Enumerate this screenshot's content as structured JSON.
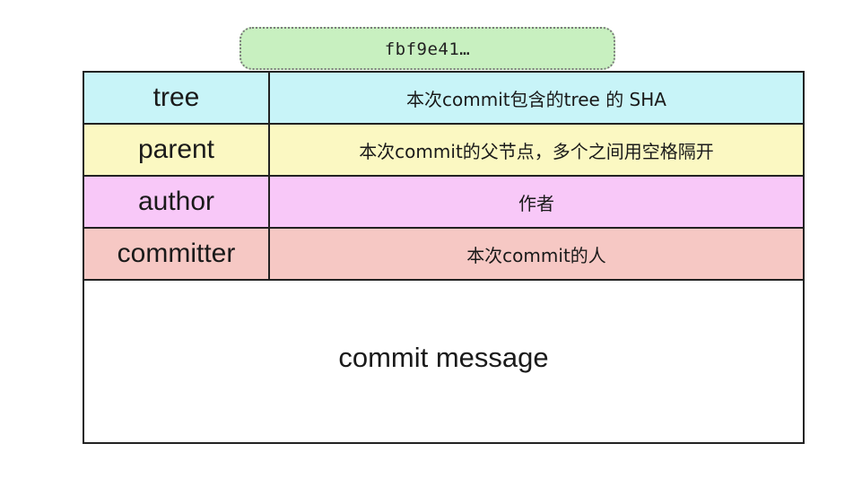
{
  "commit_hash": "fbf9e41…",
  "colors": {
    "tree": "#c8f4f8",
    "parent": "#fbf8c2",
    "author": "#f8c8f8",
    "committer": "#f6c8c4",
    "hash_badge": "#c8f0c0",
    "border": "#222222"
  },
  "rows": [
    {
      "key": "tree",
      "value": "本次commit包含的tree 的 SHA"
    },
    {
      "key": "parent",
      "value": "本次commit的父节点，多个之间用空格隔开"
    },
    {
      "key": "author",
      "value": "作者"
    },
    {
      "key": "committer",
      "value": "本次commit的人"
    }
  ],
  "message": "commit message"
}
